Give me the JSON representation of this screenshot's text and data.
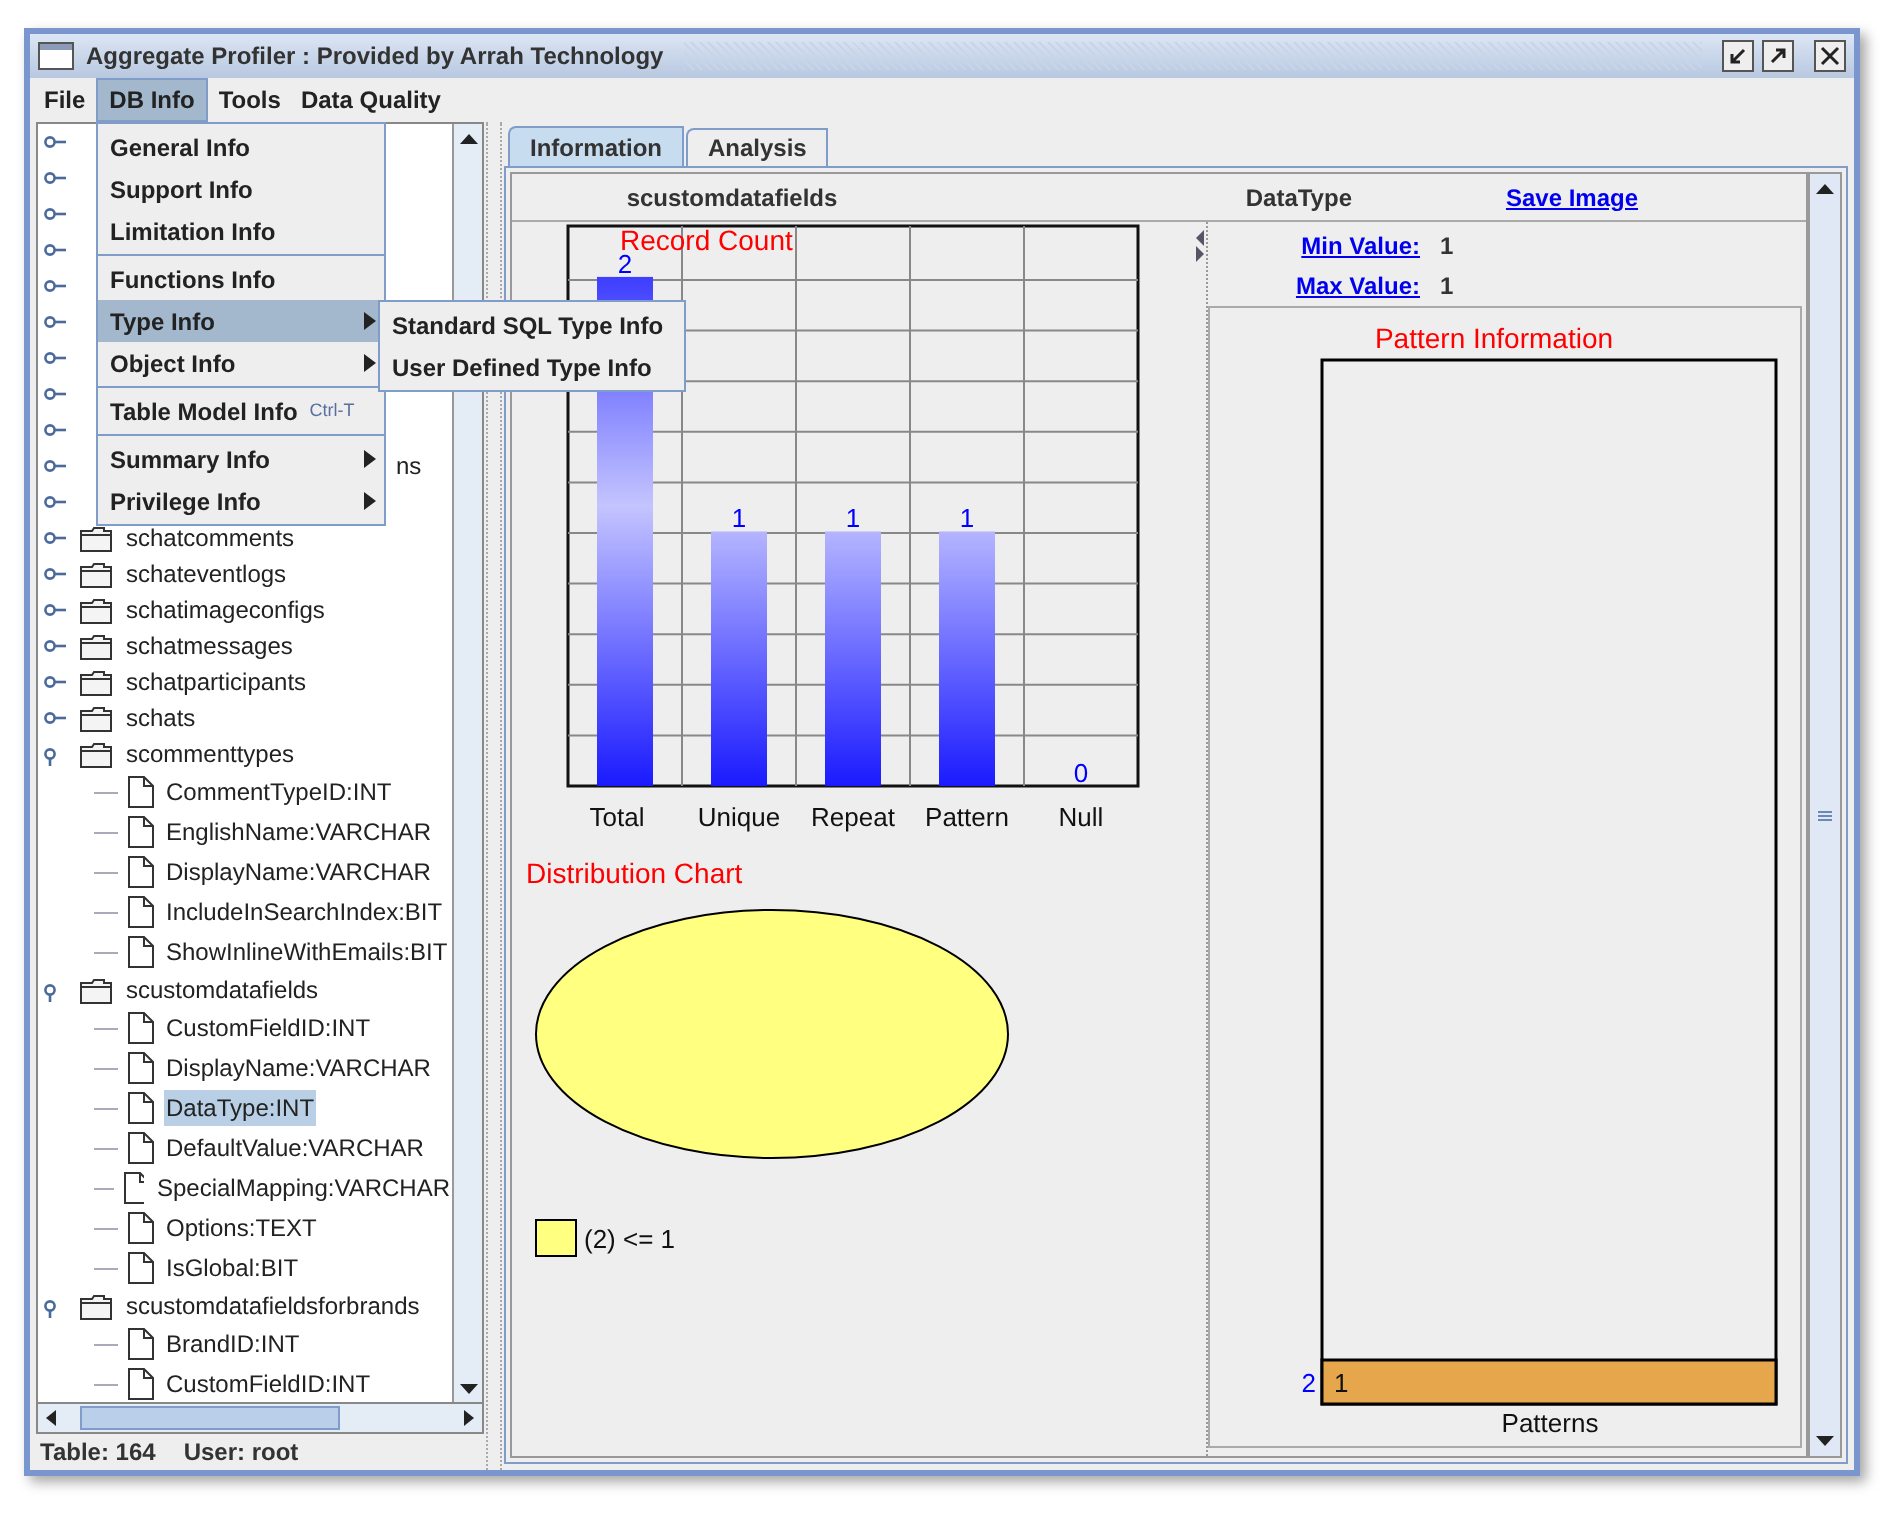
{
  "window": {
    "title": "Aggregate Profiler : Provided by Arrah Technology"
  },
  "menubar": [
    {
      "label": "File",
      "selected": false
    },
    {
      "label": "DB Info",
      "selected": true
    },
    {
      "label": "Tools",
      "selected": false
    },
    {
      "label": "Data Quality",
      "selected": false
    }
  ],
  "dropdown": [
    {
      "kind": "item",
      "label": "General Info",
      "selected": false
    },
    {
      "kind": "item",
      "label": "Support Info",
      "selected": false
    },
    {
      "kind": "item",
      "label": "Limitation Info",
      "selected": false
    },
    {
      "kind": "separator"
    },
    {
      "kind": "item",
      "label": "Functions Info",
      "selected": false
    },
    {
      "kind": "submenu",
      "label": "Type Info",
      "selected": true
    },
    {
      "kind": "submenu",
      "label": "Object Info",
      "selected": false
    },
    {
      "kind": "separator"
    },
    {
      "kind": "item",
      "label": "Table Model Info",
      "shortcut": "Ctrl-T",
      "selected": false
    },
    {
      "kind": "separator"
    },
    {
      "kind": "submenu",
      "label": "Summary Info",
      "selected": false
    },
    {
      "kind": "submenu",
      "label": "Privilege Info",
      "selected": false
    }
  ],
  "submenu": [
    {
      "label": "Standard SQL Type Info",
      "selected": false
    },
    {
      "label": "User Defined Type Info",
      "selected": false
    }
  ],
  "tree": [
    {
      "expanded": false
    },
    {
      "expanded": false
    },
    {
      "expanded": false
    },
    {
      "expanded": false
    },
    {
      "expanded": false
    },
    {
      "expanded": false
    },
    {
      "expanded": false
    },
    {
      "expanded": false
    },
    {
      "expanded": false
    },
    {
      "label": "ns",
      "expanded": false,
      "covered": true
    },
    {
      "expanded": false
    },
    {
      "label": "schatcomments",
      "expanded": false
    },
    {
      "label": "schateventlogs",
      "expanded": false
    },
    {
      "label": "schatimageconfigs",
      "expanded": false
    },
    {
      "label": "schatmessages",
      "expanded": false
    },
    {
      "label": "schatparticipants",
      "expanded": false
    },
    {
      "label": "schats",
      "expanded": false
    },
    {
      "label": "scommenttypes",
      "expanded": true,
      "children": [
        {
          "label": "CommentTypeID:INT",
          "selected": false
        },
        {
          "label": "EnglishName:VARCHAR",
          "selected": false
        },
        {
          "label": "DisplayName:VARCHAR",
          "selected": false
        },
        {
          "label": "IncludeInSearchIndex:BIT",
          "selected": false
        },
        {
          "label": "ShowInlineWithEmails:BIT",
          "selected": false
        }
      ]
    },
    {
      "label": "scustomdatafields",
      "expanded": true,
      "children": [
        {
          "label": "CustomFieldID:INT",
          "selected": false
        },
        {
          "label": "DisplayName:VARCHAR",
          "selected": false
        },
        {
          "label": "DataType:INT",
          "selected": true
        },
        {
          "label": "DefaultValue:VARCHAR",
          "selected": false
        },
        {
          "label": "SpecialMapping:VARCHAR",
          "selected": false
        },
        {
          "label": "Options:TEXT",
          "selected": false
        },
        {
          "label": "IsGlobal:BIT",
          "selected": false
        }
      ]
    },
    {
      "label": "scustomdatafieldsforbrands",
      "expanded": true,
      "children": [
        {
          "label": "BrandID:INT",
          "selected": false
        },
        {
          "label": "CustomFieldID:INT",
          "selected": false
        }
      ]
    }
  ],
  "status_bar": {
    "table": "Table: 164",
    "user": "User: root"
  },
  "tabs": [
    {
      "label": "Information",
      "selected": true
    },
    {
      "label": "Analysis",
      "selected": false
    }
  ],
  "header": {
    "table": "scustomdatafields",
    "column": "DataType",
    "save_link": "Save Image"
  },
  "stats": [
    {
      "label": "Min Value:",
      "value": "1"
    },
    {
      "label": "Max Value:",
      "value": "1"
    }
  ],
  "record_chart": {
    "chart_data": {
      "type": "bar",
      "title": "Record Count",
      "categories": [
        "Total",
        "Unique",
        "Repeat",
        "Pattern",
        "Null"
      ],
      "values": [
        2,
        1,
        1,
        1,
        0
      ],
      "ylim": [
        0,
        2.2
      ],
      "data_labels": true
    }
  },
  "distribution_chart": {
    "title": "Distribution Chart",
    "legend": [
      {
        "label": "(2) <= 1",
        "color": "#ffff80"
      }
    ]
  },
  "pattern_chart": {
    "chart_data": {
      "type": "bar",
      "orientation": "horizontal",
      "title": "Pattern Information",
      "xlabel": "Patterns",
      "categories": [
        "1"
      ],
      "values": [
        2
      ],
      "data_labels": true
    }
  }
}
